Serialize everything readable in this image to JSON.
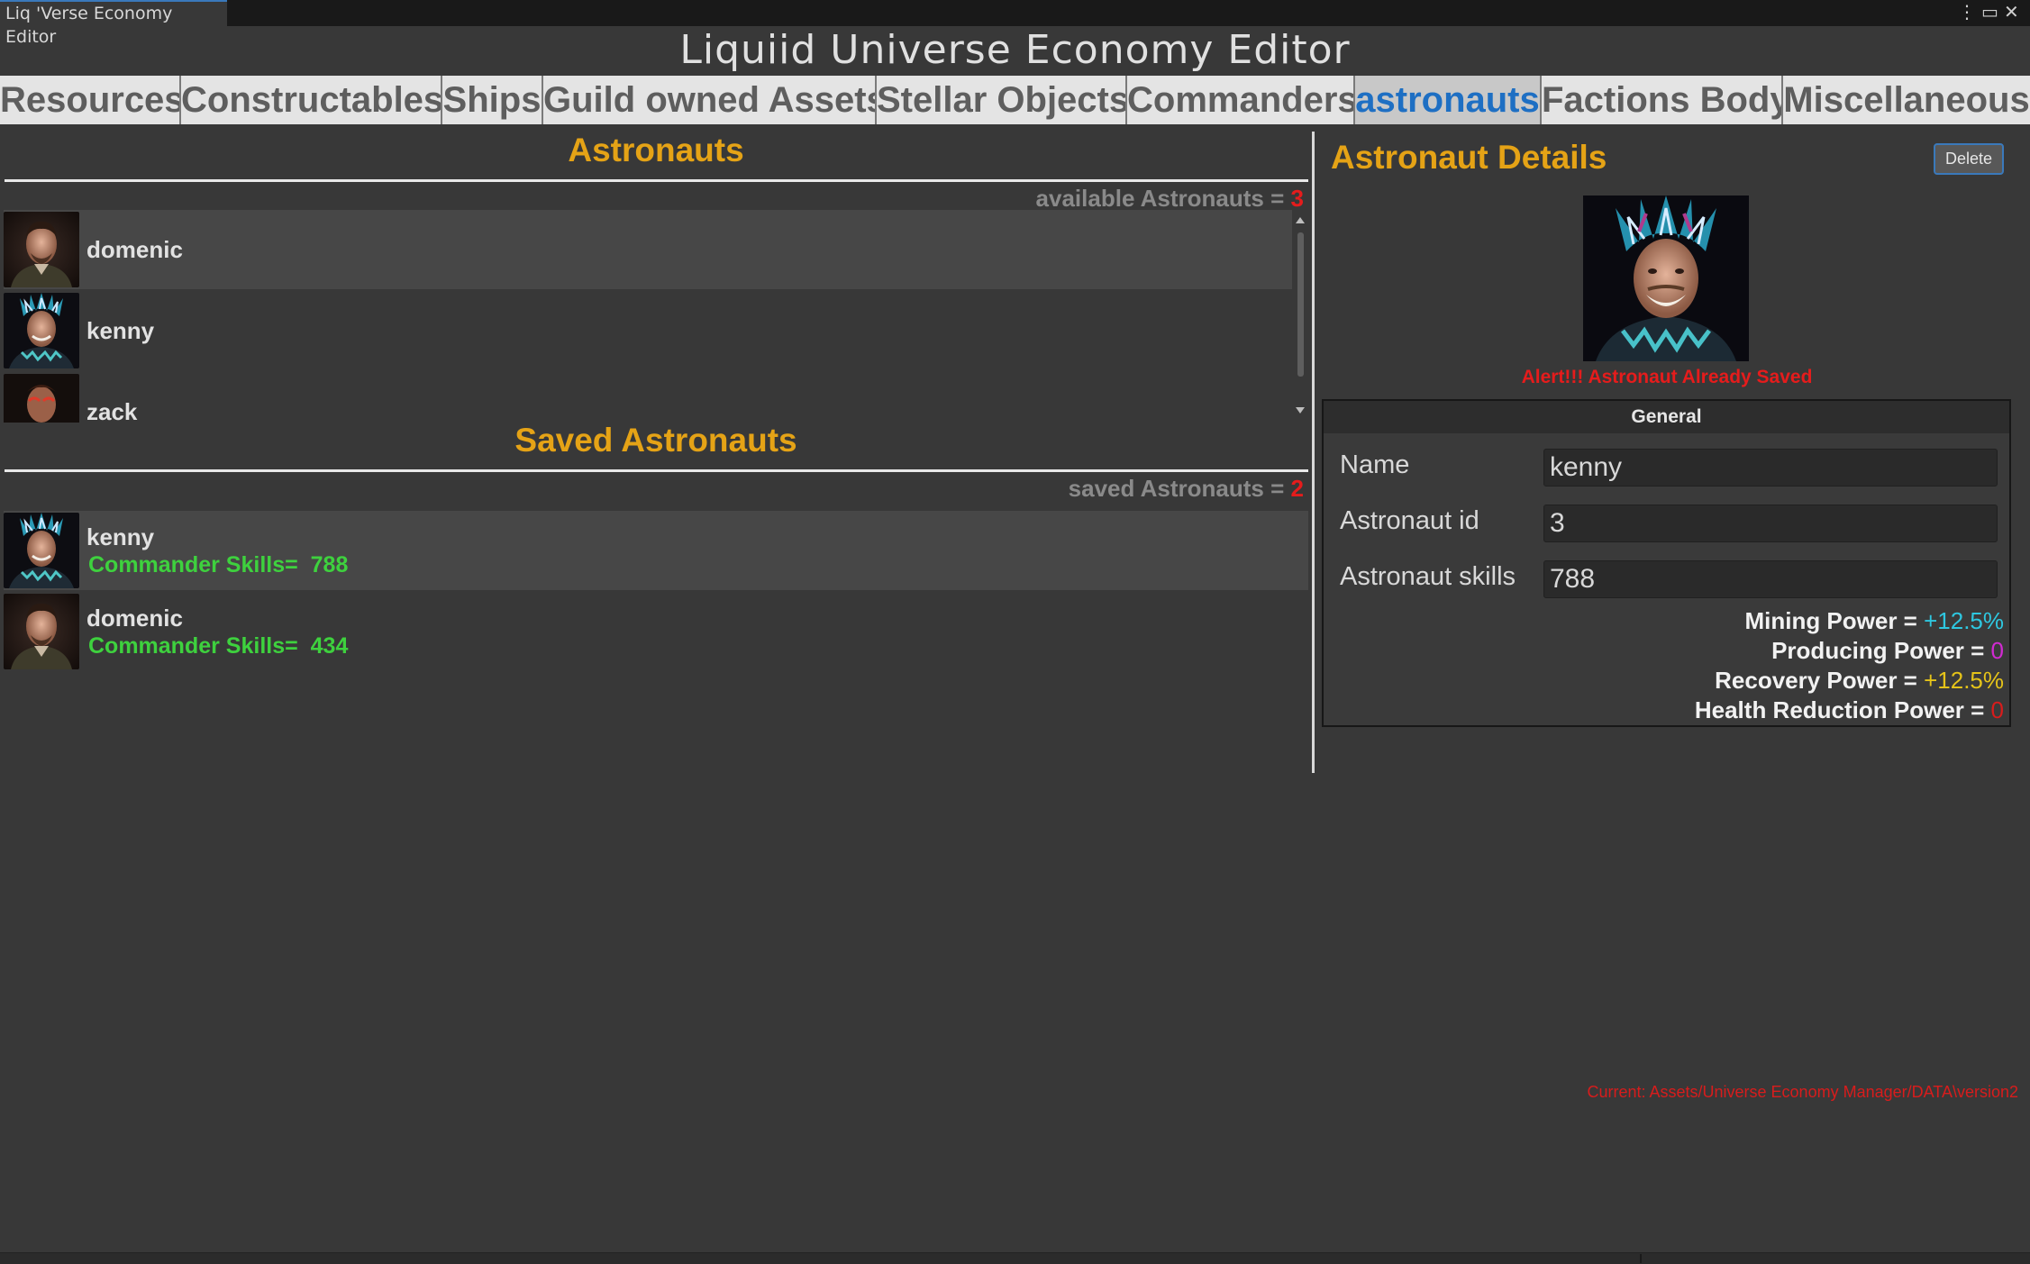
{
  "window": {
    "tab_title": "Liq 'Verse Economy Editor",
    "controls": {
      "menu": "⋮",
      "maximize": "▭",
      "close": "✕"
    }
  },
  "app_title": "Liquiid Universe Economy Editor",
  "tabs": [
    {
      "label": "Resources"
    },
    {
      "label": "Constructables"
    },
    {
      "label": "Ships"
    },
    {
      "label": "Guild owned Assets"
    },
    {
      "label": "Stellar Objects"
    },
    {
      "label": "Commanders"
    },
    {
      "label": "astronauts",
      "active": true
    },
    {
      "label": "Factions Body"
    },
    {
      "label": "Miscellaneous"
    }
  ],
  "astronauts": {
    "heading": "Astronauts",
    "count_label": "available Astronauts = ",
    "count": "3",
    "items": [
      {
        "name": "domenic"
      },
      {
        "name": "kenny"
      },
      {
        "name": "zack"
      }
    ]
  },
  "saved": {
    "heading": "Saved Astronauts",
    "count_label": "saved Astronauts = ",
    "count": "2",
    "items": [
      {
        "name": "kenny",
        "skills_label": "Commander Skills=",
        "skills": "788"
      },
      {
        "name": "domenic",
        "skills_label": "Commander Skills=",
        "skills": "434"
      }
    ]
  },
  "details": {
    "title": "Astronaut Details",
    "delete_label": "Delete",
    "alert": "Alert!!! Astronaut Already Saved",
    "section": "General",
    "fields": {
      "name_label": "Name",
      "name_value": "kenny",
      "id_label": "Astronaut id",
      "id_value": "3",
      "skills_label": "Astronaut skills",
      "skills_value": "788"
    },
    "powers": [
      {
        "label": "Mining Power = ",
        "value": "+12.5%",
        "color": "#2ec7e0"
      },
      {
        "label": "Producing Power = ",
        "value": "0",
        "color": "#d12ad1"
      },
      {
        "label": "Recovery Power = ",
        "value": "+12.5%",
        "color": "#e5c319"
      },
      {
        "label": "Health Reduction Power = ",
        "value": "0",
        "color": "#d81c1c"
      }
    ]
  },
  "footer_path": "Current: Assets/Universe Economy Manager/DATA\\version2"
}
